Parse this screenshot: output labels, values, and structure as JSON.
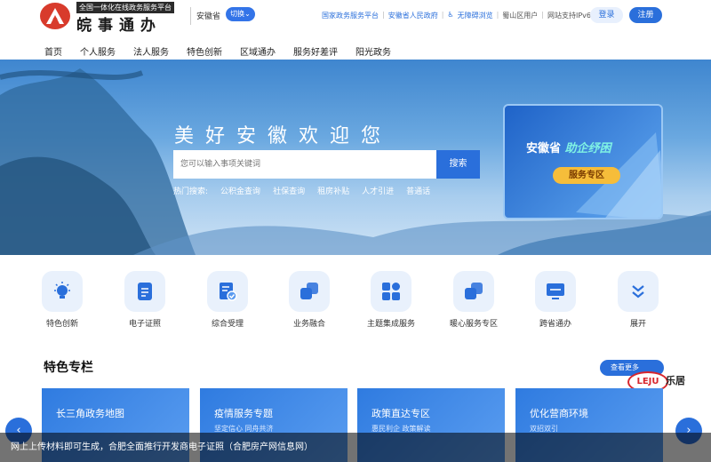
{
  "header": {
    "logo_subtitle": "全国一体化在线政务服务平台",
    "logo_title": "皖事通办",
    "region": "安徽省",
    "switch_label": "切换",
    "links": [
      "国家政务服务平台",
      "安徽省人民政府",
      "无障碍浏览",
      "蜀山区用户",
      "网站支持IPv6"
    ],
    "login": "登录",
    "register": "注册"
  },
  "nav": [
    "首页",
    "个人服务",
    "法人服务",
    "特色创新",
    "区域通办",
    "服务好差评",
    "阳光政务"
  ],
  "banner": {
    "title": "美好安徽欢迎您",
    "search_placeholder": "您可以输入事项关键词",
    "search_button": "搜索",
    "hot_label": "热门搜索:",
    "hot_items": [
      "公积金查询",
      "社保查询",
      "租房补贴",
      "人才引进",
      "普通话"
    ],
    "promo_title_prefix": "安徽省",
    "promo_title_highlight": "助企纾困",
    "promo_button": "服务专区"
  },
  "services": [
    {
      "label": "特色创新",
      "icon": "bulb-icon"
    },
    {
      "label": "电子证照",
      "icon": "document-icon"
    },
    {
      "label": "综合受理",
      "icon": "form-check-icon"
    },
    {
      "label": "业务融合",
      "icon": "merge-icon"
    },
    {
      "label": "主题集成服务",
      "icon": "grid-icon"
    },
    {
      "label": "暖心服务专区",
      "icon": "heart-zone-icon"
    },
    {
      "label": "跨省通办",
      "icon": "monitor-icon"
    },
    {
      "label": "展开",
      "icon": "chevron-down-icon"
    }
  ],
  "section": {
    "title": "特色专栏",
    "more": "查看更多"
  },
  "watermark": {
    "logo": "LEJU",
    "text": "乐居"
  },
  "cards": [
    {
      "title": "长三角政务地图",
      "sub": ""
    },
    {
      "title": "疫情服务专题",
      "sub": "坚定信心 同舟共济"
    },
    {
      "title": "政策直达专区",
      "sub": "惠民利企 政策解读"
    },
    {
      "title": "优化营商环境",
      "sub": "双招双引"
    }
  ],
  "caption": "网上上传材料即可生成，合肥全面推行开发商电子证照（合肥房产网信息网）",
  "colors": {
    "primary": "#2a6fdb",
    "logo": "#d83b2c",
    "promo_button": "#f6bd3a"
  }
}
